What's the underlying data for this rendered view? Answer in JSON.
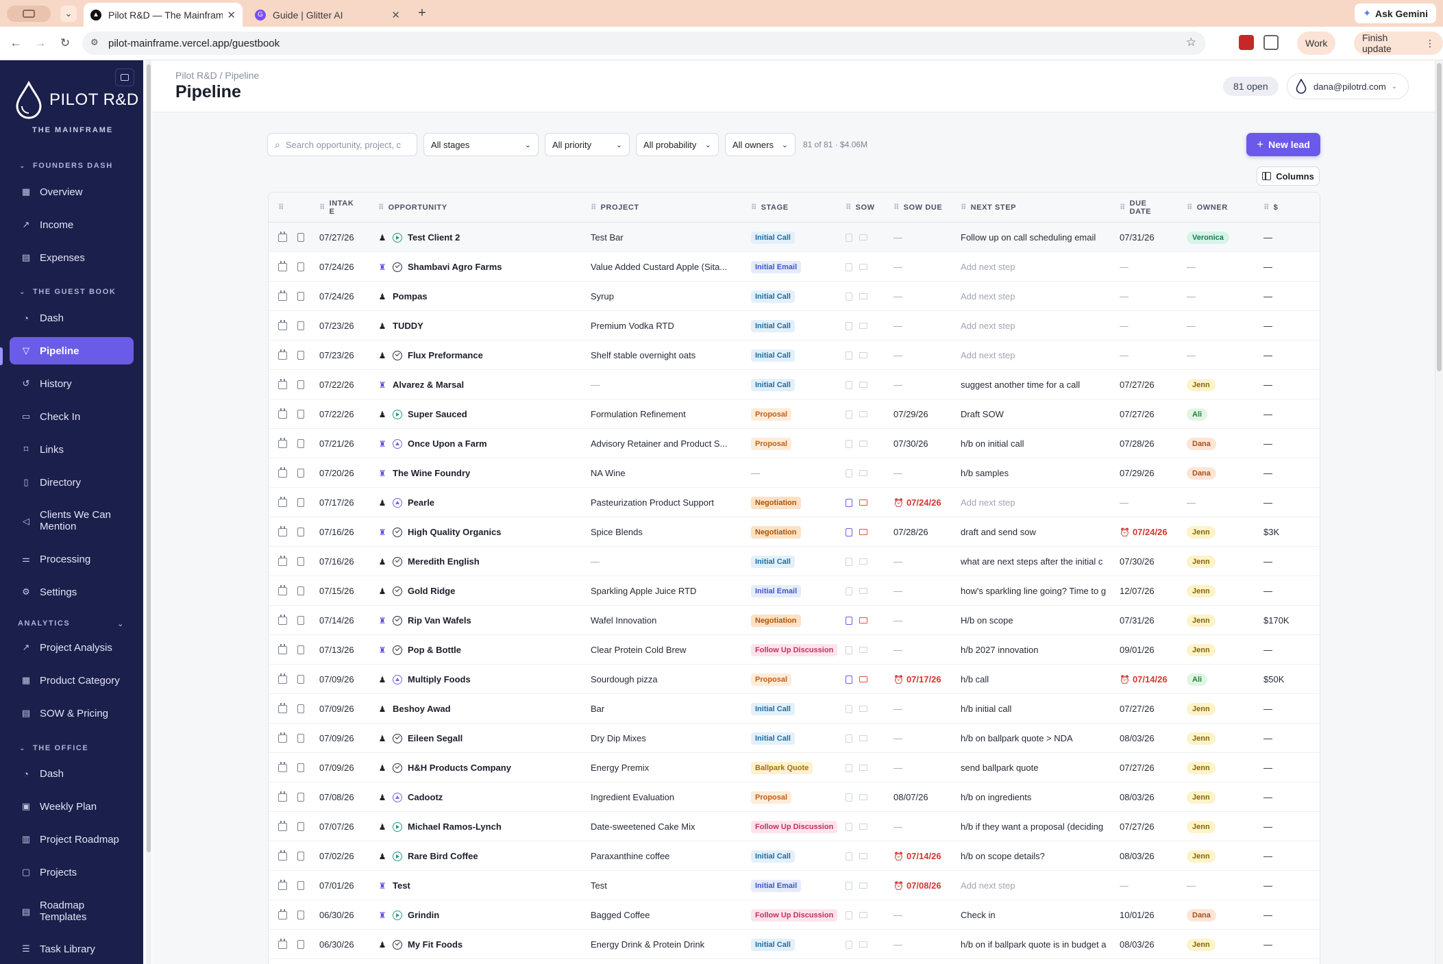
{
  "browser": {
    "tabs": [
      {
        "title": "Pilot R&D — The Mainframe",
        "active": true
      },
      {
        "title": "Guide | Glitter AI",
        "active": false
      }
    ],
    "ask_gemini": "Ask Gemini",
    "url": "pilot-mainframe.vercel.app/guestbook",
    "profile_label": "Work",
    "update_label": "Finish update"
  },
  "sidebar": {
    "brand": "PILOT R&D",
    "brand_sub": "THE MAINFRAME",
    "sections": {
      "founders": "FOUNDERS DASH",
      "guestbook": "THE GUEST BOOK",
      "analytics": "ANALYTICS",
      "office": "THE OFFICE"
    },
    "items": [
      {
        "label": "Overview",
        "icon": "grid-icon"
      },
      {
        "label": "Income",
        "icon": "trend-icon"
      },
      {
        "label": "Expenses",
        "icon": "receipt-icon"
      },
      {
        "label": "Dash",
        "icon": "gauge-icon"
      },
      {
        "label": "Pipeline",
        "icon": "funnel-icon",
        "active": true
      },
      {
        "label": "History",
        "icon": "history-icon"
      },
      {
        "label": "Check In",
        "icon": "clipboard-icon"
      },
      {
        "label": "Links",
        "icon": "bookmark-icon"
      },
      {
        "label": "Directory",
        "icon": "book-icon"
      },
      {
        "label": "Clients We Can Mention",
        "icon": "megaphone-icon"
      },
      {
        "label": "Processing",
        "icon": "sliders-icon"
      },
      {
        "label": "Settings",
        "icon": "gear-icon"
      },
      {
        "label": "Project Analysis",
        "icon": "chart-icon"
      },
      {
        "label": "Product Category",
        "icon": "grid-icon"
      },
      {
        "label": "SOW & Pricing",
        "icon": "receipt-icon"
      },
      {
        "label": "Dash",
        "icon": "gauge-icon"
      },
      {
        "label": "Weekly Plan",
        "icon": "calendar-icon"
      },
      {
        "label": "Project Roadmap",
        "icon": "map-icon"
      },
      {
        "label": "Projects",
        "icon": "folder-icon"
      },
      {
        "label": "Roadmap Templates",
        "icon": "template-icon"
      },
      {
        "label": "Task Library",
        "icon": "list-icon"
      }
    ]
  },
  "header": {
    "breadcrumb": "Pilot R&D / Pipeline",
    "title": "Pipeline",
    "open_count": "81 open",
    "user_email": "dana@pilotrd.com"
  },
  "filters": {
    "search_placeholder": "Search opportunity, project, c",
    "stages": "All stages",
    "priority": "All priority",
    "probability": "All probability",
    "owners": "All owners",
    "summary": "81 of 81 · $4.06M",
    "new_lead": "New lead",
    "columns": "Columns"
  },
  "table": {
    "headers": {
      "intake": "INTAK E",
      "opportunity": "OPPORTUNITY",
      "project": "PROJECT",
      "stage": "STAGE",
      "sow": "SOW",
      "sow_due": "SOW DUE",
      "next_step": "NEXT STEP",
      "due_date": "DUE DATE",
      "owner": "OWNER",
      "amount": "$"
    },
    "rows": [
      {
        "intake": "07/27/26",
        "opportunity": "Test Client 2",
        "type": "person",
        "status": "play",
        "project": "Test Bar",
        "stage": "Initial Call",
        "sow": false,
        "sow_due": "—",
        "sow_due_overdue": false,
        "next_step": "Follow up on call scheduling email",
        "next_muted": false,
        "due": "07/31/26",
        "due_overdue": false,
        "owner": "Veronica",
        "amount": "—"
      },
      {
        "intake": "07/24/26",
        "opportunity": "Shambavi Agro Farms",
        "type": "group",
        "status": "check",
        "project": "Value Added Custard Apple (Sita...",
        "stage": "Initial Email",
        "sow": false,
        "sow_due": "—",
        "sow_due_overdue": false,
        "next_step": "Add next step",
        "next_muted": true,
        "due": "—",
        "due_overdue": false,
        "owner": "—",
        "amount": "—"
      },
      {
        "intake": "07/24/26",
        "opportunity": "Pompas",
        "type": "person",
        "status": "none",
        "project": "Syrup",
        "stage": "Initial Call",
        "sow": false,
        "sow_due": "—",
        "sow_due_overdue": false,
        "next_step": "Add next step",
        "next_muted": true,
        "due": "—",
        "due_overdue": false,
        "owner": "—",
        "amount": "—"
      },
      {
        "intake": "07/23/26",
        "opportunity": "TUDDY",
        "type": "person",
        "status": "none",
        "project": "Premium Vodka RTD",
        "stage": "Initial Call",
        "sow": false,
        "sow_due": "—",
        "sow_due_overdue": false,
        "next_step": "Add next step",
        "next_muted": true,
        "due": "—",
        "due_overdue": false,
        "owner": "—",
        "amount": "—"
      },
      {
        "intake": "07/23/26",
        "opportunity": "Flux Preformance",
        "type": "person",
        "status": "check",
        "project": "Shelf stable overnight oats",
        "stage": "Initial Call",
        "sow": false,
        "sow_due": "—",
        "sow_due_overdue": false,
        "next_step": "Add next step",
        "next_muted": true,
        "due": "—",
        "due_overdue": false,
        "owner": "—",
        "amount": "—"
      },
      {
        "intake": "07/22/26",
        "opportunity": "Alvarez & Marsal",
        "type": "group",
        "status": "none",
        "project": "—",
        "stage": "Initial Call",
        "sow": false,
        "sow_due": "—",
        "sow_due_overdue": false,
        "next_step": "suggest another time for a call",
        "next_muted": false,
        "due": "07/27/26",
        "due_overdue": false,
        "owner": "Jenn",
        "amount": "—"
      },
      {
        "intake": "07/22/26",
        "opportunity": "Super Sauced",
        "type": "person",
        "status": "play",
        "project": "Formulation Refinement",
        "stage": "Proposal",
        "sow": false,
        "sow_due": "07/29/26",
        "sow_due_overdue": false,
        "next_step": "Draft SOW",
        "next_muted": false,
        "due": "07/27/26",
        "due_overdue": false,
        "owner": "Ali",
        "amount": "—"
      },
      {
        "intake": "07/21/26",
        "opportunity": "Once Upon a Farm",
        "type": "group",
        "status": "up",
        "project": "Advisory Retainer and Product S...",
        "stage": "Proposal",
        "sow": false,
        "sow_due": "07/30/26",
        "sow_due_overdue": false,
        "next_step": "h/b on initial call",
        "next_muted": false,
        "due": "07/28/26",
        "due_overdue": false,
        "owner": "Dana",
        "amount": "—"
      },
      {
        "intake": "07/20/26",
        "opportunity": "The Wine Foundry",
        "type": "group",
        "status": "none",
        "project": "NA Wine",
        "stage": "—",
        "sow": false,
        "sow_due": "—",
        "sow_due_overdue": false,
        "next_step": "h/b samples",
        "next_muted": false,
        "due": "07/29/26",
        "due_overdue": false,
        "owner": "Dana",
        "amount": "—"
      },
      {
        "intake": "07/17/26",
        "opportunity": "Pearle",
        "type": "person",
        "status": "up",
        "project": "Pasteurization Product Support",
        "stage": "Negotiation",
        "sow": true,
        "sow_due": "07/24/26",
        "sow_due_overdue": true,
        "next_step": "Add next step",
        "next_muted": true,
        "due": "—",
        "due_overdue": false,
        "owner": "—",
        "amount": "—"
      },
      {
        "intake": "07/16/26",
        "opportunity": "High Quality Organics",
        "type": "group",
        "status": "check",
        "project": "Spice Blends",
        "stage": "Negotiation",
        "sow": true,
        "sow_due": "07/28/26",
        "sow_due_overdue": false,
        "next_step": "draft and send sow",
        "next_muted": false,
        "due": "07/24/26",
        "due_overdue": true,
        "owner": "Jenn",
        "amount": "$3K"
      },
      {
        "intake": "07/16/26",
        "opportunity": "Meredith English",
        "type": "person",
        "status": "check",
        "project": "—",
        "stage": "Initial Call",
        "sow": false,
        "sow_due": "—",
        "sow_due_overdue": false,
        "next_step": "what are next steps after the initial c",
        "next_muted": false,
        "due": "07/30/26",
        "due_overdue": false,
        "owner": "Jenn",
        "amount": "—"
      },
      {
        "intake": "07/15/26",
        "opportunity": "Gold Ridge",
        "type": "person",
        "status": "check",
        "project": "Sparkling Apple Juice RTD",
        "stage": "Initial Email",
        "sow": false,
        "sow_due": "—",
        "sow_due_overdue": false,
        "next_step": "how's sparkling line going? Time to g",
        "next_muted": false,
        "due": "12/07/26",
        "due_overdue": false,
        "owner": "Jenn",
        "amount": "—"
      },
      {
        "intake": "07/14/26",
        "opportunity": "Rip Van Wafels",
        "type": "group",
        "status": "check",
        "project": "Wafel Innovation",
        "stage": "Negotiation",
        "sow": true,
        "sow_due": "—",
        "sow_due_overdue": false,
        "next_step": "H/b on scope",
        "next_muted": false,
        "due": "07/31/26",
        "due_overdue": false,
        "owner": "Jenn",
        "amount": "$170K"
      },
      {
        "intake": "07/13/26",
        "opportunity": "Pop & Bottle",
        "type": "group",
        "status": "check",
        "project": "Clear Protein Cold Brew",
        "stage": "Follow Up Discussion",
        "sow": false,
        "sow_due": "—",
        "sow_due_overdue": false,
        "next_step": "h/b 2027 innovation",
        "next_muted": false,
        "due": "09/01/26",
        "due_overdue": false,
        "owner": "Jenn",
        "amount": "—"
      },
      {
        "intake": "07/09/26",
        "opportunity": "Multiply Foods",
        "type": "person",
        "status": "up",
        "project": "Sourdough pizza",
        "stage": "Proposal",
        "sow": true,
        "sow_due": "07/17/26",
        "sow_due_overdue": true,
        "next_step": "h/b call",
        "next_muted": false,
        "due": "07/14/26",
        "due_overdue": true,
        "owner": "Ali",
        "amount": "$50K"
      },
      {
        "intake": "07/09/26",
        "opportunity": "Beshoy Awad",
        "type": "person",
        "status": "none",
        "project": "Bar",
        "stage": "Initial Call",
        "sow": false,
        "sow_due": "—",
        "sow_due_overdue": false,
        "next_step": "h/b initial call",
        "next_muted": false,
        "due": "07/27/26",
        "due_overdue": false,
        "owner": "Jenn",
        "amount": "—"
      },
      {
        "intake": "07/09/26",
        "opportunity": "Eileen Segall",
        "type": "person",
        "status": "check",
        "project": "Dry Dip Mixes",
        "stage": "Initial Call",
        "sow": false,
        "sow_due": "—",
        "sow_due_overdue": false,
        "next_step": "h/b on ballpark quote > NDA",
        "next_muted": false,
        "due": "08/03/26",
        "due_overdue": false,
        "owner": "Jenn",
        "amount": "—"
      },
      {
        "intake": "07/09/26",
        "opportunity": "H&H Products Company",
        "type": "person",
        "status": "check",
        "project": "Energy Premix",
        "stage": "Ballpark Quote",
        "sow": false,
        "sow_due": "—",
        "sow_due_overdue": false,
        "next_step": "send ballpark quote",
        "next_muted": false,
        "due": "07/27/26",
        "due_overdue": false,
        "owner": "Jenn",
        "amount": "—"
      },
      {
        "intake": "07/08/26",
        "opportunity": "Cadootz",
        "type": "person",
        "status": "up",
        "project": "Ingredient Evaluation",
        "stage": "Proposal",
        "sow": false,
        "sow_due": "08/07/26",
        "sow_due_overdue": false,
        "next_step": "h/b on ingredients",
        "next_muted": false,
        "due": "08/03/26",
        "due_overdue": false,
        "owner": "Jenn",
        "amount": "—"
      },
      {
        "intake": "07/07/26",
        "opportunity": "Michael Ramos-Lynch",
        "type": "person",
        "status": "play",
        "project": "Date-sweetened Cake Mix",
        "stage": "Follow Up Discussion",
        "sow": false,
        "sow_due": "—",
        "sow_due_overdue": false,
        "next_step": "h/b if they want a proposal (deciding",
        "next_muted": false,
        "due": "07/27/26",
        "due_overdue": false,
        "owner": "Jenn",
        "amount": "—"
      },
      {
        "intake": "07/02/26",
        "opportunity": "Rare Bird Coffee",
        "type": "person",
        "status": "play",
        "project": "Paraxanthine coffee",
        "stage": "Initial Call",
        "sow": false,
        "sow_due": "07/14/26",
        "sow_due_overdue": true,
        "next_step": "h/b on scope details?",
        "next_muted": false,
        "due": "08/03/26",
        "due_overdue": false,
        "owner": "Jenn",
        "amount": "—"
      },
      {
        "intake": "07/01/26",
        "opportunity": "Test",
        "type": "group",
        "status": "none",
        "project": "Test",
        "stage": "Initial Email",
        "sow": false,
        "sow_due": "07/08/26",
        "sow_due_overdue": true,
        "next_step": "Add next step",
        "next_muted": true,
        "due": "—",
        "due_overdue": false,
        "owner": "—",
        "amount": "—"
      },
      {
        "intake": "06/30/26",
        "opportunity": "Grindin",
        "type": "group",
        "status": "play",
        "project": "Bagged Coffee",
        "stage": "Follow Up Discussion",
        "sow": false,
        "sow_due": "—",
        "sow_due_overdue": false,
        "next_step": "Check in",
        "next_muted": false,
        "due": "10/01/26",
        "due_overdue": false,
        "owner": "Dana",
        "amount": "—"
      },
      {
        "intake": "06/30/26",
        "opportunity": "My Fit Foods",
        "type": "person",
        "status": "check",
        "project": "Energy Drink & Protein Drink",
        "stage": "Initial Call",
        "sow": false,
        "sow_due": "—",
        "sow_due_overdue": false,
        "next_step": "h/b on if ballpark quote is in budget a",
        "next_muted": false,
        "due": "08/03/26",
        "due_overdue": false,
        "owner": "Jenn",
        "amount": "—"
      }
    ]
  },
  "colors": {
    "sidebar_bg": "#1b1f4b",
    "accent": "#6b5ae9",
    "tabstrip": "#f7d8c6",
    "overdue": "#d8342f"
  }
}
